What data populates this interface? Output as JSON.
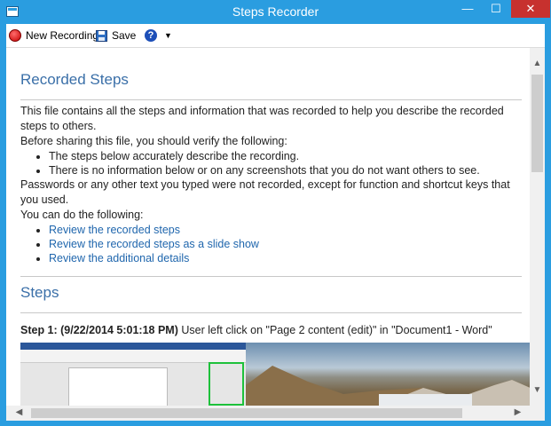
{
  "window": {
    "title": "Steps Recorder",
    "min_glyph": "—",
    "max_glyph": "☐",
    "close_glyph": "✕"
  },
  "toolbar": {
    "new_recording": "New Recording",
    "save": "Save",
    "help_glyph": "?",
    "dropdown_glyph": "▼"
  },
  "content": {
    "heading_recorded": "Recorded Steps",
    "intro": "This file contains all the steps and information that was recorded to help you describe the recorded steps to others.",
    "verify_intro": "Before sharing this file, you should verify the following:",
    "verify_items": [
      "The steps below accurately describe the recording.",
      "There is no information below or on any screenshots that you do not want others to see."
    ],
    "passwords_note": "Passwords or any other text you typed were not recorded, except for function and shortcut keys that you used.",
    "can_do": "You can do the following:",
    "links": [
      "Review the recorded steps",
      "Review the recorded steps as a slide show",
      "Review the additional details"
    ],
    "heading_steps": "Steps",
    "step1_label": "Step 1: (9/22/2014 5:01:18 PM)",
    "step1_text": " User left click on \"Page 2 content (edit)\" in \"Document1 - Word\""
  },
  "scroll": {
    "up": "▲",
    "down": "▼",
    "left": "◀",
    "right": "▶"
  },
  "colors": {
    "frame": "#2a9de0",
    "close": "#c7312e",
    "heading": "#3a6fa8",
    "link": "#1f66ad"
  }
}
